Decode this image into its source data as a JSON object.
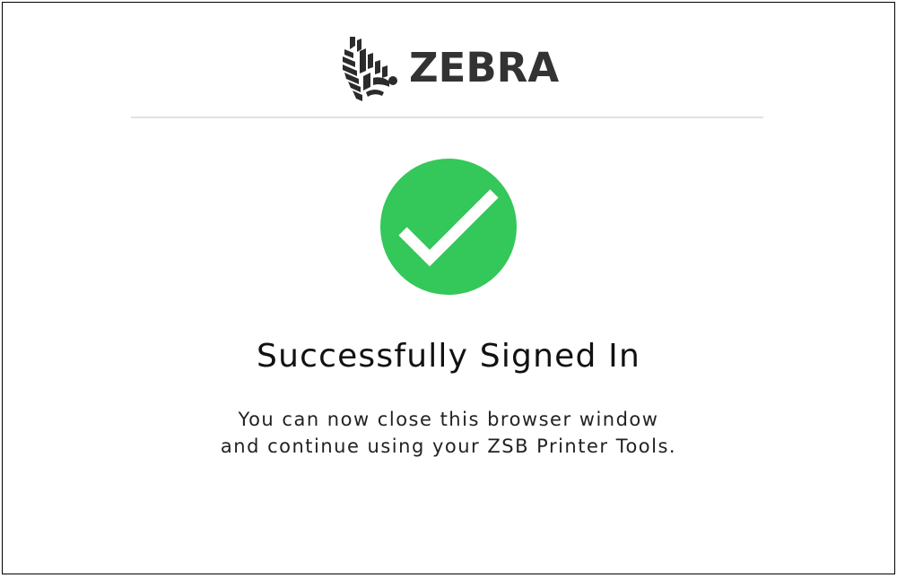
{
  "brand": {
    "name": "ZEBRA",
    "logo_icon": "zebra-head-icon"
  },
  "status": {
    "icon": "check-circle-icon",
    "color": "#34c759",
    "title": "Successfully Signed In",
    "message_line1": "You can now close this browser window",
    "message_line2": "and continue using your ZSB Printer Tools."
  }
}
